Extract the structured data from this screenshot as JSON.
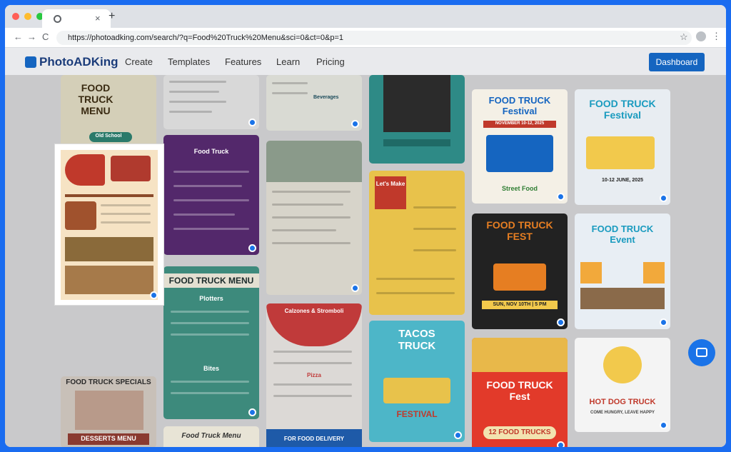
{
  "browser": {
    "url": "https://photoadking.com/search/?q=Food%20Truck%20Menu&sci=0&ct=0&p=1",
    "tab_close": "×",
    "new_tab": "+",
    "back": "←",
    "forward": "→",
    "reload": "C",
    "bookmark": "☆",
    "menu": "⋮"
  },
  "site": {
    "logo": "PhotoADKing",
    "nav": [
      "Create",
      "Templates",
      "Features",
      "Learn",
      "Pricing"
    ],
    "dashboard": "Dashboard"
  },
  "cards": {
    "c1_title": "FOOD TRUCK MENU",
    "c1_sub": "Old School",
    "c2_title": "FOOD TRUCK MENU",
    "c3_title": "FOOD TRUCK SPECIALS",
    "c3_sub": "DESSERTS MENU",
    "c4_top": "Beverages",
    "c5_title": "Food Truck",
    "c6_title": "FOOD TRUCK MENU",
    "c6_sub": "Plotters",
    "c6_sub2": "Bites",
    "c7_title": "Food Truck Menu",
    "c8_title": "Calzones & Stromboli",
    "c8_sub": "Pizza",
    "c8_foot": "FOR FOOD DELIVERY",
    "c9_title": "Let's Make",
    "c10_title": "TACOS TRUCK",
    "c10_sub": "FESTIVAL",
    "c11_title": "FOOD TRUCK Festival",
    "c11_date": "NOVEMBER 10-12, 2025",
    "c11_sub": "Street Food",
    "c12_title": "FOOD TRUCK FEST",
    "c12_date": "SUN, NOV 10TH | 5 PM",
    "c13_title": "FOOD TRUCK Fest",
    "c13_sub": "12 FOOD TRUCKS",
    "c14_title": "FOOD TRUCK Festival",
    "c14_date": "10-12 JUNE, 2025",
    "c15_title": "FOOD TRUCK Event",
    "c16_title": "HOT DOG TRUCK",
    "c16_sub": "COME HUNGRY, LEAVE HAPPY"
  },
  "colors": {
    "accent": "#1565c0",
    "selection_border": "#ffffff"
  }
}
